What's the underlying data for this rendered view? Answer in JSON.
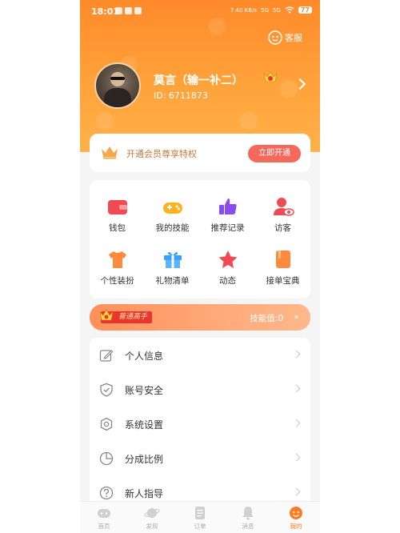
{
  "status_bar": {
    "time": "18:01",
    "battery": "77",
    "net_speed": "7.40 KB/s",
    "signal1": "5G",
    "signal2": "5G"
  },
  "header": {
    "service_label": "客服"
  },
  "profile": {
    "name": "莫言（输一补二）",
    "id": "ID: 6711873"
  },
  "vip": {
    "text": "开通会员尊享特权",
    "button": "立即开通"
  },
  "grid": [
    {
      "label": "钱包",
      "icon": "wallet-icon",
      "color": "#f04b55"
    },
    {
      "label": "我的技能",
      "icon": "gamepad-icon",
      "color": "#ffb21f"
    },
    {
      "label": "推荐记录",
      "icon": "thumbs-up-icon",
      "color": "#8a4cf0"
    },
    {
      "label": "访客",
      "icon": "visitor-icon",
      "color": "#f04b55"
    },
    {
      "label": "个性装扮",
      "icon": "tshirt-icon",
      "color": "#ff8a3c"
    },
    {
      "label": "礼物清单",
      "icon": "gift-icon",
      "color": "#3aa0ff"
    },
    {
      "label": "动态",
      "icon": "star-icon",
      "color": "#f04b55"
    },
    {
      "label": "接单宝典",
      "icon": "book-icon",
      "color": "#ff8a3c"
    }
  ],
  "level": {
    "tag": "普通高手",
    "skill": "技能值:0",
    "arrow": "»"
  },
  "menu": [
    {
      "label": "个人信息",
      "icon": "edit-icon"
    },
    {
      "label": "账号安全",
      "icon": "shield-icon"
    },
    {
      "label": "系统设置",
      "icon": "gear-icon"
    },
    {
      "label": "分成比例",
      "icon": "pie-icon"
    },
    {
      "label": "新人指导",
      "icon": "help-icon"
    }
  ],
  "tabs": [
    {
      "label": "首页",
      "icon": "home-icon"
    },
    {
      "label": "发现",
      "icon": "planet-icon"
    },
    {
      "label": "订单",
      "icon": "order-icon"
    },
    {
      "label": "消息",
      "icon": "bell-icon"
    },
    {
      "label": "我的",
      "icon": "profile-icon",
      "active": true
    }
  ],
  "colors": {
    "accent": "#ff8a2a",
    "vip_button": "#f4695c",
    "vip_text": "#c5793a"
  }
}
